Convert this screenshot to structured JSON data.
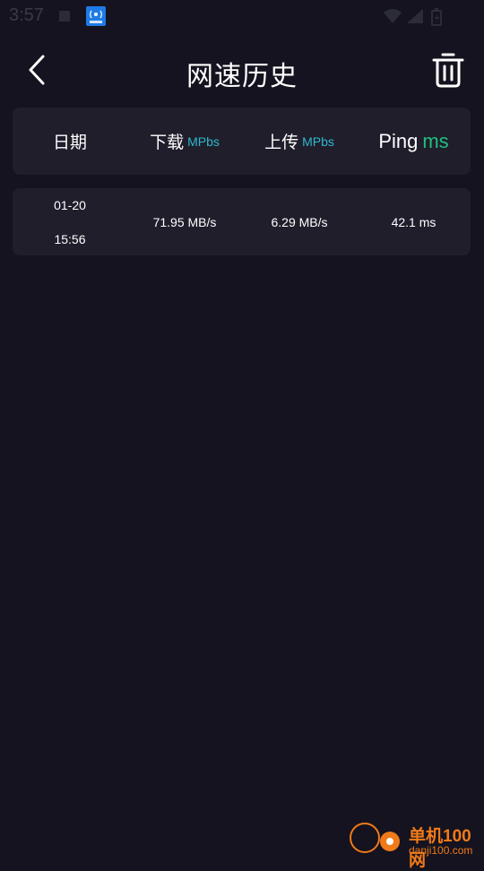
{
  "status_bar": {
    "time": "3:57"
  },
  "header": {
    "title": "网速历史"
  },
  "table": {
    "columns": {
      "date": "日期",
      "download": "下载",
      "download_unit": "MPbs",
      "upload": "上传",
      "upload_unit": "MPbs",
      "ping": "Ping",
      "ping_unit": "ms"
    },
    "rows": [
      {
        "date": "01-20",
        "time": "15:56",
        "download": "71.95 MB/s",
        "upload": "6.29 MB/s",
        "ping": "42.1 ms"
      }
    ]
  },
  "watermark": {
    "title": "单机100网",
    "url": "danji100.com"
  },
  "colors": {
    "background": "#15131f",
    "card": "#201e2b",
    "unit_cyan": "#2fb8cf",
    "ping_green": "#1fc07e",
    "watermark_orange": "#f07a1a"
  }
}
